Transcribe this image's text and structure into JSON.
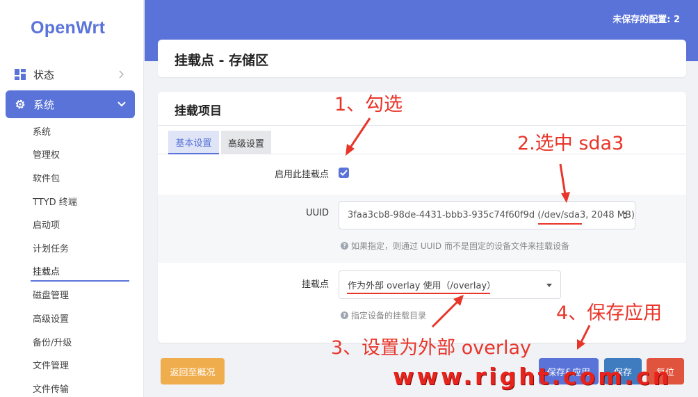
{
  "app": {
    "logo": "OpenWrt",
    "unsaved": "未保存的配置: 2"
  },
  "sidebar": {
    "status_label": "状态",
    "system_label": "系统",
    "sub_items": [
      "系统",
      "管理权",
      "软件包",
      "TTYD 终端",
      "启动项",
      "计划任务",
      "挂载点",
      "磁盘管理",
      "高级设置",
      "备份/升级",
      "文件管理",
      "文件传输"
    ],
    "active_sub": "挂载点"
  },
  "page": {
    "title": "挂载点 - 存储区",
    "section_title": "挂载项目"
  },
  "tabs": {
    "basic": "基本设置",
    "advanced": "高级设置"
  },
  "form": {
    "enable_label": "启用此挂载点",
    "enable_checked": true,
    "uuid_label": "UUID",
    "uuid_value": "3faa3cb8-98de-4431-bbb3-935c74f60f9d (/dev/sda3, 2048 MB)",
    "uuid_help": "如果指定，则通过 UUID 而不是固定的设备文件来挂载设备",
    "mount_label": "挂载点",
    "mount_value": "作为外部 overlay 使用（/overlay）",
    "mount_help": "指定设备的挂载目录"
  },
  "buttons": {
    "back": "返回至概况",
    "save_apply": "保存&应用",
    "save": "保存",
    "reset": "复位"
  },
  "annotations": {
    "step1": "1、勾选",
    "step2": "2.选中 sda3",
    "step3": "3、设置为外部 overlay",
    "step4": "4、保存应用",
    "watermark": "www.right.com.cn"
  },
  "colors": {
    "accent": "#5a73d9",
    "annotation": "#e8352a",
    "warning": "#f0ad4e",
    "danger": "#e0533d",
    "primary": "#3f7bbf"
  }
}
